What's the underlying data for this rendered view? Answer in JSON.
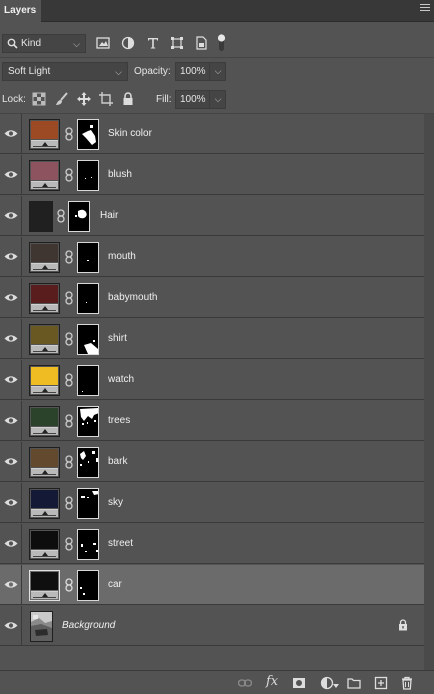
{
  "panel": {
    "tab_label": "Layers"
  },
  "filter": {
    "kind_label": "Kind"
  },
  "blend": {
    "mode": "Soft Light",
    "opacity_label": "Opacity:",
    "opacity_value": "100%"
  },
  "lock": {
    "lock_label": "Lock:",
    "fill_label": "Fill:",
    "fill_value": "100%"
  },
  "layers": [
    {
      "name": "Skin color",
      "color": "#9c4a24",
      "type": "adjustment",
      "selected": false
    },
    {
      "name": "blush",
      "color": "#8d5460",
      "type": "adjustment",
      "selected": false
    },
    {
      "name": "Hair",
      "color": "#202020",
      "type": "plain",
      "selected": false
    },
    {
      "name": "mouth",
      "color": "#3f3531",
      "type": "adjustment",
      "selected": false
    },
    {
      "name": "babymouth",
      "color": "#5a1d1e",
      "type": "adjustment",
      "selected": false
    },
    {
      "name": "shirt",
      "color": "#695822",
      "type": "adjustment",
      "selected": false
    },
    {
      "name": "watch",
      "color": "#efbd23",
      "type": "adjustment",
      "selected": false
    },
    {
      "name": "trees",
      "color": "#2b422b",
      "type": "adjustment",
      "selected": false
    },
    {
      "name": "bark",
      "color": "#634a2f",
      "type": "adjustment",
      "selected": false
    },
    {
      "name": "sky",
      "color": "#141a36",
      "type": "adjustment",
      "selected": false
    },
    {
      "name": "street",
      "color": "#0d0d0d",
      "type": "adjustment",
      "selected": false
    },
    {
      "name": "car",
      "color": "#0f0f0f",
      "type": "adjustment",
      "selected": true
    },
    {
      "name": "Background",
      "color": "#777777",
      "type": "background",
      "selected": false
    }
  ]
}
